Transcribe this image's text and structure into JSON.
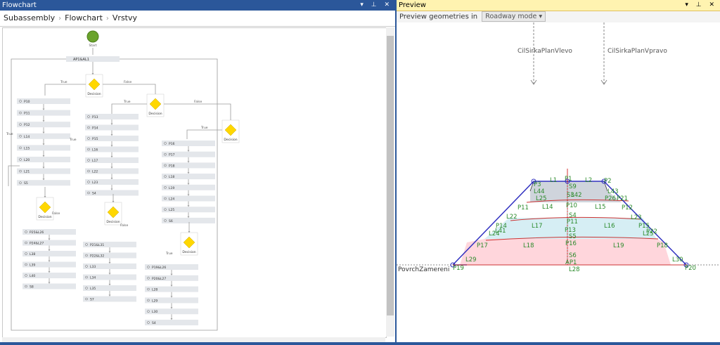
{
  "flowchart": {
    "title": "Flowchart",
    "window_icons": "▾ ⊥ ✕",
    "breadcrumb": [
      "Subassembly",
      "Flowchart",
      "Vrstvy"
    ],
    "start_label": "Start",
    "top_node": "AP1&AL1",
    "decision_label": "Decision",
    "true_label": "True",
    "false_label": "False",
    "col1": [
      "P10",
      "P11",
      "P12",
      "L14",
      "L15",
      "L20",
      "L21",
      "S5"
    ],
    "col2": [
      "P13",
      "P14",
      "P15",
      "L16",
      "L17",
      "L22",
      "L23",
      "S4"
    ],
    "col3": [
      "P16",
      "P17",
      "P18",
      "L18",
      "L19",
      "L24",
      "L25",
      "S6"
    ],
    "bottom1": [
      "P25&L26",
      "P24&L27",
      "L38",
      "L39",
      "L40",
      "S8"
    ],
    "bottom2": [
      "P21&L31",
      "P22&L32",
      "L33",
      "L34",
      "L35",
      "S7"
    ],
    "bottom3": [
      "P19&L26",
      "P20&L27",
      "L28",
      "L29",
      "L30",
      "S4"
    ]
  },
  "preview": {
    "title": "Preview",
    "window_icons": "▾ ⊥ ✕",
    "toolbar_label": "Preview geometries in",
    "mode_value": "Roadway mode",
    "target_left": "CilSirkaPlanVlevo",
    "target_right": "CilSirkaPlanVpravo",
    "surface_label": "PovrchZamereni",
    "labels": {
      "P1": "P1",
      "L1": "L1",
      "L2": "L2",
      "S9": "S9",
      "P2": "P2",
      "P3": "P3",
      "L44": "L44",
      "L25": "L25",
      "L42": "L42",
      "L43": "L43",
      "P26": "P26",
      "P21": "P21",
      "P10": "P10",
      "P11": "P11",
      "L14": "L14",
      "L15": "L15",
      "P12": "P12",
      "S4": "S4",
      "L22": "L22",
      "L23": "L23",
      "P11b": "P11",
      "L17": "L17",
      "L16": "L16",
      "P13": "P13",
      "P14": "P14",
      "P15": "P15",
      "L24": "L24",
      "L25b": "L25",
      "S5": "S5",
      "P16": "P16",
      "P17": "P17",
      "P18": "P18",
      "L18": "L18",
      "L19": "L19",
      "S6": "S6",
      "AP1": "AP1",
      "L29": "L29",
      "L30": "L30",
      "L28": "L28",
      "P19": "P19",
      "P20": "P20",
      "L41": "L41",
      "P22": "P22",
      "S3": "S3"
    },
    "colors": {
      "top": "#cfd4dc",
      "mid": "#d6eef4",
      "bottom": "#ffd6dc",
      "outline": "#3030c0",
      "label": "#2a8a2a",
      "red": "#cc0000"
    }
  }
}
